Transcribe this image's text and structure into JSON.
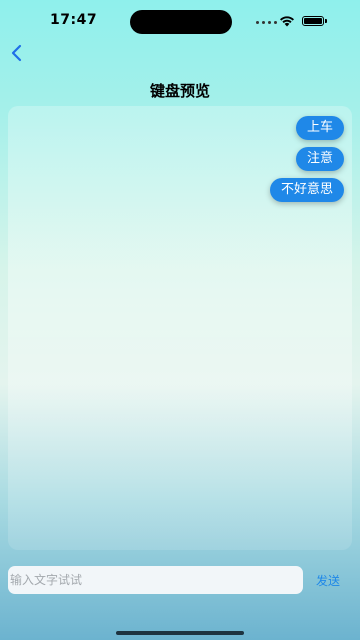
{
  "status_bar": {
    "time": "17:47",
    "icons": [
      "signal-dots-icon",
      "wifi-icon",
      "battery-icon"
    ]
  },
  "nav": {
    "back_icon": "chevron-left-icon",
    "title": "键盘预览"
  },
  "messages": [
    {
      "text": "上车"
    },
    {
      "text": "注意"
    },
    {
      "text": "不好意思"
    }
  ],
  "composer": {
    "placeholder": "输入文字试试",
    "value": "",
    "send_label": "发送"
  },
  "colors": {
    "accent": "#1f88e8",
    "bubble_text": "#ffffff",
    "input_background": "#f2f6f9"
  }
}
